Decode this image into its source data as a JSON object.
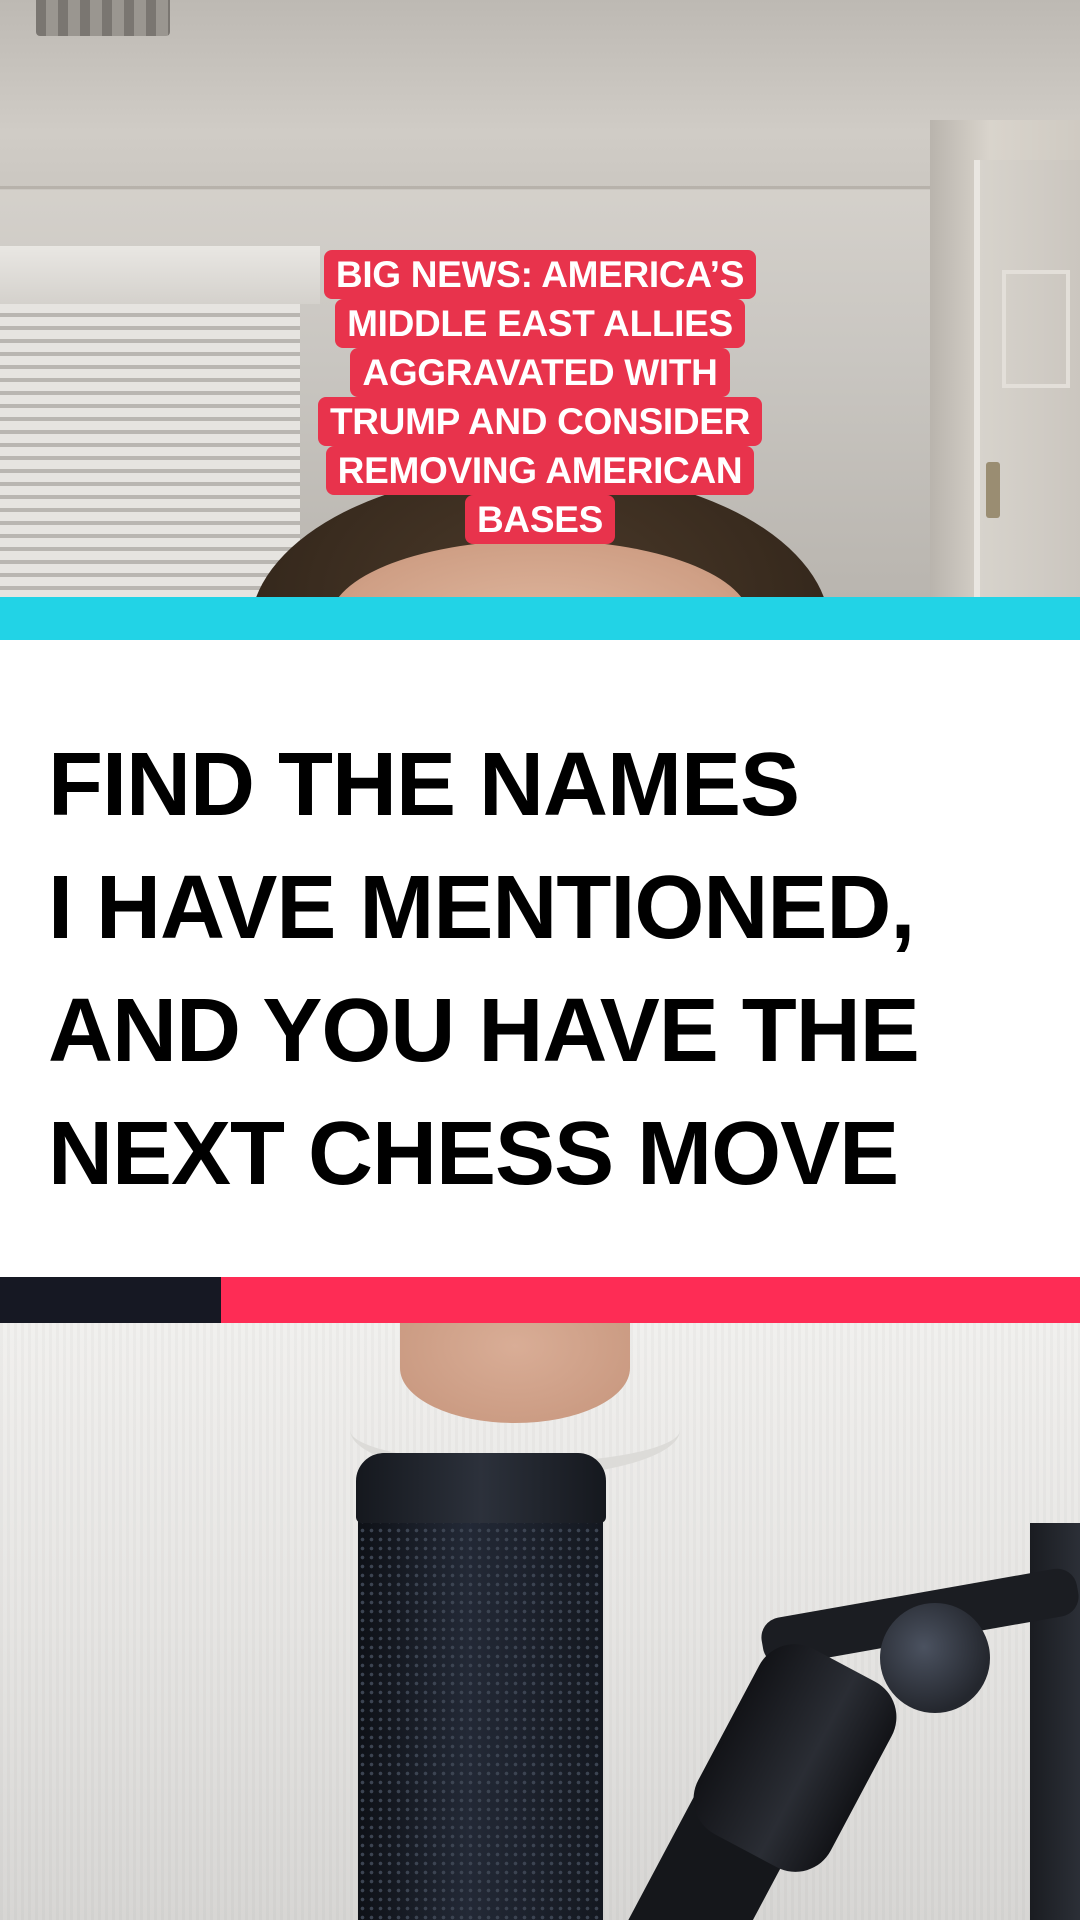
{
  "overlay_caption": {
    "lines": [
      "BIG NEWS: AMERICA’S",
      "MIDDLE EAST ALLIES",
      "AGGRAVATED WITH",
      "TRUMP AND CONSIDER",
      "REMOVING AMERICAN",
      "BASES"
    ],
    "background_color": "#e8334c",
    "text_color": "#ffffff"
  },
  "headline": {
    "lines": [
      "FIND THE NAMES",
      "I HAVE MENTIONED,",
      "AND YOU HAVE THE",
      "NEXT CHESS MOVE"
    ],
    "text_color": "#000000"
  },
  "colors": {
    "top_bar": "#22d3e6",
    "progress_played": "#161823",
    "progress_remaining": "#fe2c55",
    "panel_background": "#ffffff"
  },
  "playback": {
    "progress_fraction": 0.205
  }
}
